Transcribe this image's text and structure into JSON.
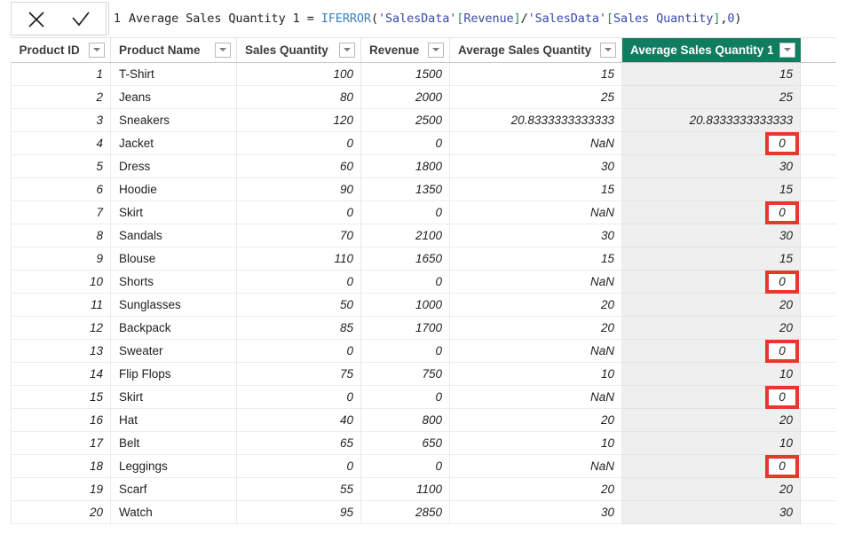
{
  "formula_bar": {
    "cancel_label": "✕",
    "accept_label": "✓",
    "line_number": "1",
    "formula_full": "Average Sales Quantity 1 = IFERROR('SalesData'[Revenue]/'SalesData'[Sales Quantity],0)",
    "tokens": {
      "measure_name": "Average Sales Quantity 1 = ",
      "function": "IFERROR",
      "open_paren": "(",
      "table1": "'SalesData'",
      "open_brkt1": "[",
      "column1": "Revenue",
      "close_brkt1": "]",
      "divide": "/",
      "table2": "'SalesData'",
      "open_brkt2": "[",
      "column2": "Sales Quantity",
      "close_brkt2": "]",
      "comma": ",",
      "zero": "0",
      "close_paren": ")"
    }
  },
  "grid": {
    "columns": [
      {
        "key": "product_id",
        "label": "Product ID",
        "align": "right",
        "selected": false
      },
      {
        "key": "product_name",
        "label": "Product Name",
        "align": "left",
        "selected": false
      },
      {
        "key": "sales_quantity",
        "label": "Sales Quantity",
        "align": "right",
        "selected": false
      },
      {
        "key": "revenue",
        "label": "Revenue",
        "align": "right",
        "selected": false
      },
      {
        "key": "average_sales_quantity",
        "label": "Average Sales Quantity",
        "align": "right",
        "selected": false
      },
      {
        "key": "average_sales_quantity_1",
        "label": "Average Sales Quantity 1",
        "align": "right",
        "selected": true
      }
    ],
    "selected_column_color": "#107C60",
    "highlight_color": "#E8382C",
    "rows": [
      {
        "product_id": "1",
        "product_name": "T-Shirt",
        "sales_quantity": "100",
        "revenue": "1500",
        "average_sales_quantity": "15",
        "average_sales_quantity_1": "15",
        "highlighted": false
      },
      {
        "product_id": "2",
        "product_name": "Jeans",
        "sales_quantity": "80",
        "revenue": "2000",
        "average_sales_quantity": "25",
        "average_sales_quantity_1": "25",
        "highlighted": false
      },
      {
        "product_id": "3",
        "product_name": "Sneakers",
        "sales_quantity": "120",
        "revenue": "2500",
        "average_sales_quantity": "20.8333333333333",
        "average_sales_quantity_1": "20.8333333333333",
        "highlighted": false
      },
      {
        "product_id": "4",
        "product_name": "Jacket",
        "sales_quantity": "0",
        "revenue": "0",
        "average_sales_quantity": "NaN",
        "average_sales_quantity_1": "0",
        "highlighted": true
      },
      {
        "product_id": "5",
        "product_name": "Dress",
        "sales_quantity": "60",
        "revenue": "1800",
        "average_sales_quantity": "30",
        "average_sales_quantity_1": "30",
        "highlighted": false
      },
      {
        "product_id": "6",
        "product_name": "Hoodie",
        "sales_quantity": "90",
        "revenue": "1350",
        "average_sales_quantity": "15",
        "average_sales_quantity_1": "15",
        "highlighted": false
      },
      {
        "product_id": "7",
        "product_name": "Skirt",
        "sales_quantity": "0",
        "revenue": "0",
        "average_sales_quantity": "NaN",
        "average_sales_quantity_1": "0",
        "highlighted": true
      },
      {
        "product_id": "8",
        "product_name": "Sandals",
        "sales_quantity": "70",
        "revenue": "2100",
        "average_sales_quantity": "30",
        "average_sales_quantity_1": "30",
        "highlighted": false
      },
      {
        "product_id": "9",
        "product_name": "Blouse",
        "sales_quantity": "110",
        "revenue": "1650",
        "average_sales_quantity": "15",
        "average_sales_quantity_1": "15",
        "highlighted": false
      },
      {
        "product_id": "10",
        "product_name": "Shorts",
        "sales_quantity": "0",
        "revenue": "0",
        "average_sales_quantity": "NaN",
        "average_sales_quantity_1": "0",
        "highlighted": true
      },
      {
        "product_id": "11",
        "product_name": "Sunglasses",
        "sales_quantity": "50",
        "revenue": "1000",
        "average_sales_quantity": "20",
        "average_sales_quantity_1": "20",
        "highlighted": false
      },
      {
        "product_id": "12",
        "product_name": "Backpack",
        "sales_quantity": "85",
        "revenue": "1700",
        "average_sales_quantity": "20",
        "average_sales_quantity_1": "20",
        "highlighted": false
      },
      {
        "product_id": "13",
        "product_name": "Sweater",
        "sales_quantity": "0",
        "revenue": "0",
        "average_sales_quantity": "NaN",
        "average_sales_quantity_1": "0",
        "highlighted": true
      },
      {
        "product_id": "14",
        "product_name": "Flip Flops",
        "sales_quantity": "75",
        "revenue": "750",
        "average_sales_quantity": "10",
        "average_sales_quantity_1": "10",
        "highlighted": false
      },
      {
        "product_id": "15",
        "product_name": "Skirt",
        "sales_quantity": "0",
        "revenue": "0",
        "average_sales_quantity": "NaN",
        "average_sales_quantity_1": "0",
        "highlighted": true
      },
      {
        "product_id": "16",
        "product_name": "Hat",
        "sales_quantity": "40",
        "revenue": "800",
        "average_sales_quantity": "20",
        "average_sales_quantity_1": "20",
        "highlighted": false
      },
      {
        "product_id": "17",
        "product_name": "Belt",
        "sales_quantity": "65",
        "revenue": "650",
        "average_sales_quantity": "10",
        "average_sales_quantity_1": "10",
        "highlighted": false
      },
      {
        "product_id": "18",
        "product_name": "Leggings",
        "sales_quantity": "0",
        "revenue": "0",
        "average_sales_quantity": "NaN",
        "average_sales_quantity_1": "0",
        "highlighted": true
      },
      {
        "product_id": "19",
        "product_name": "Scarf",
        "sales_quantity": "55",
        "revenue": "1100",
        "average_sales_quantity": "20",
        "average_sales_quantity_1": "20",
        "highlighted": false
      },
      {
        "product_id": "20",
        "product_name": "Watch",
        "sales_quantity": "95",
        "revenue": "2850",
        "average_sales_quantity": "30",
        "average_sales_quantity_1": "30",
        "highlighted": false
      }
    ]
  }
}
